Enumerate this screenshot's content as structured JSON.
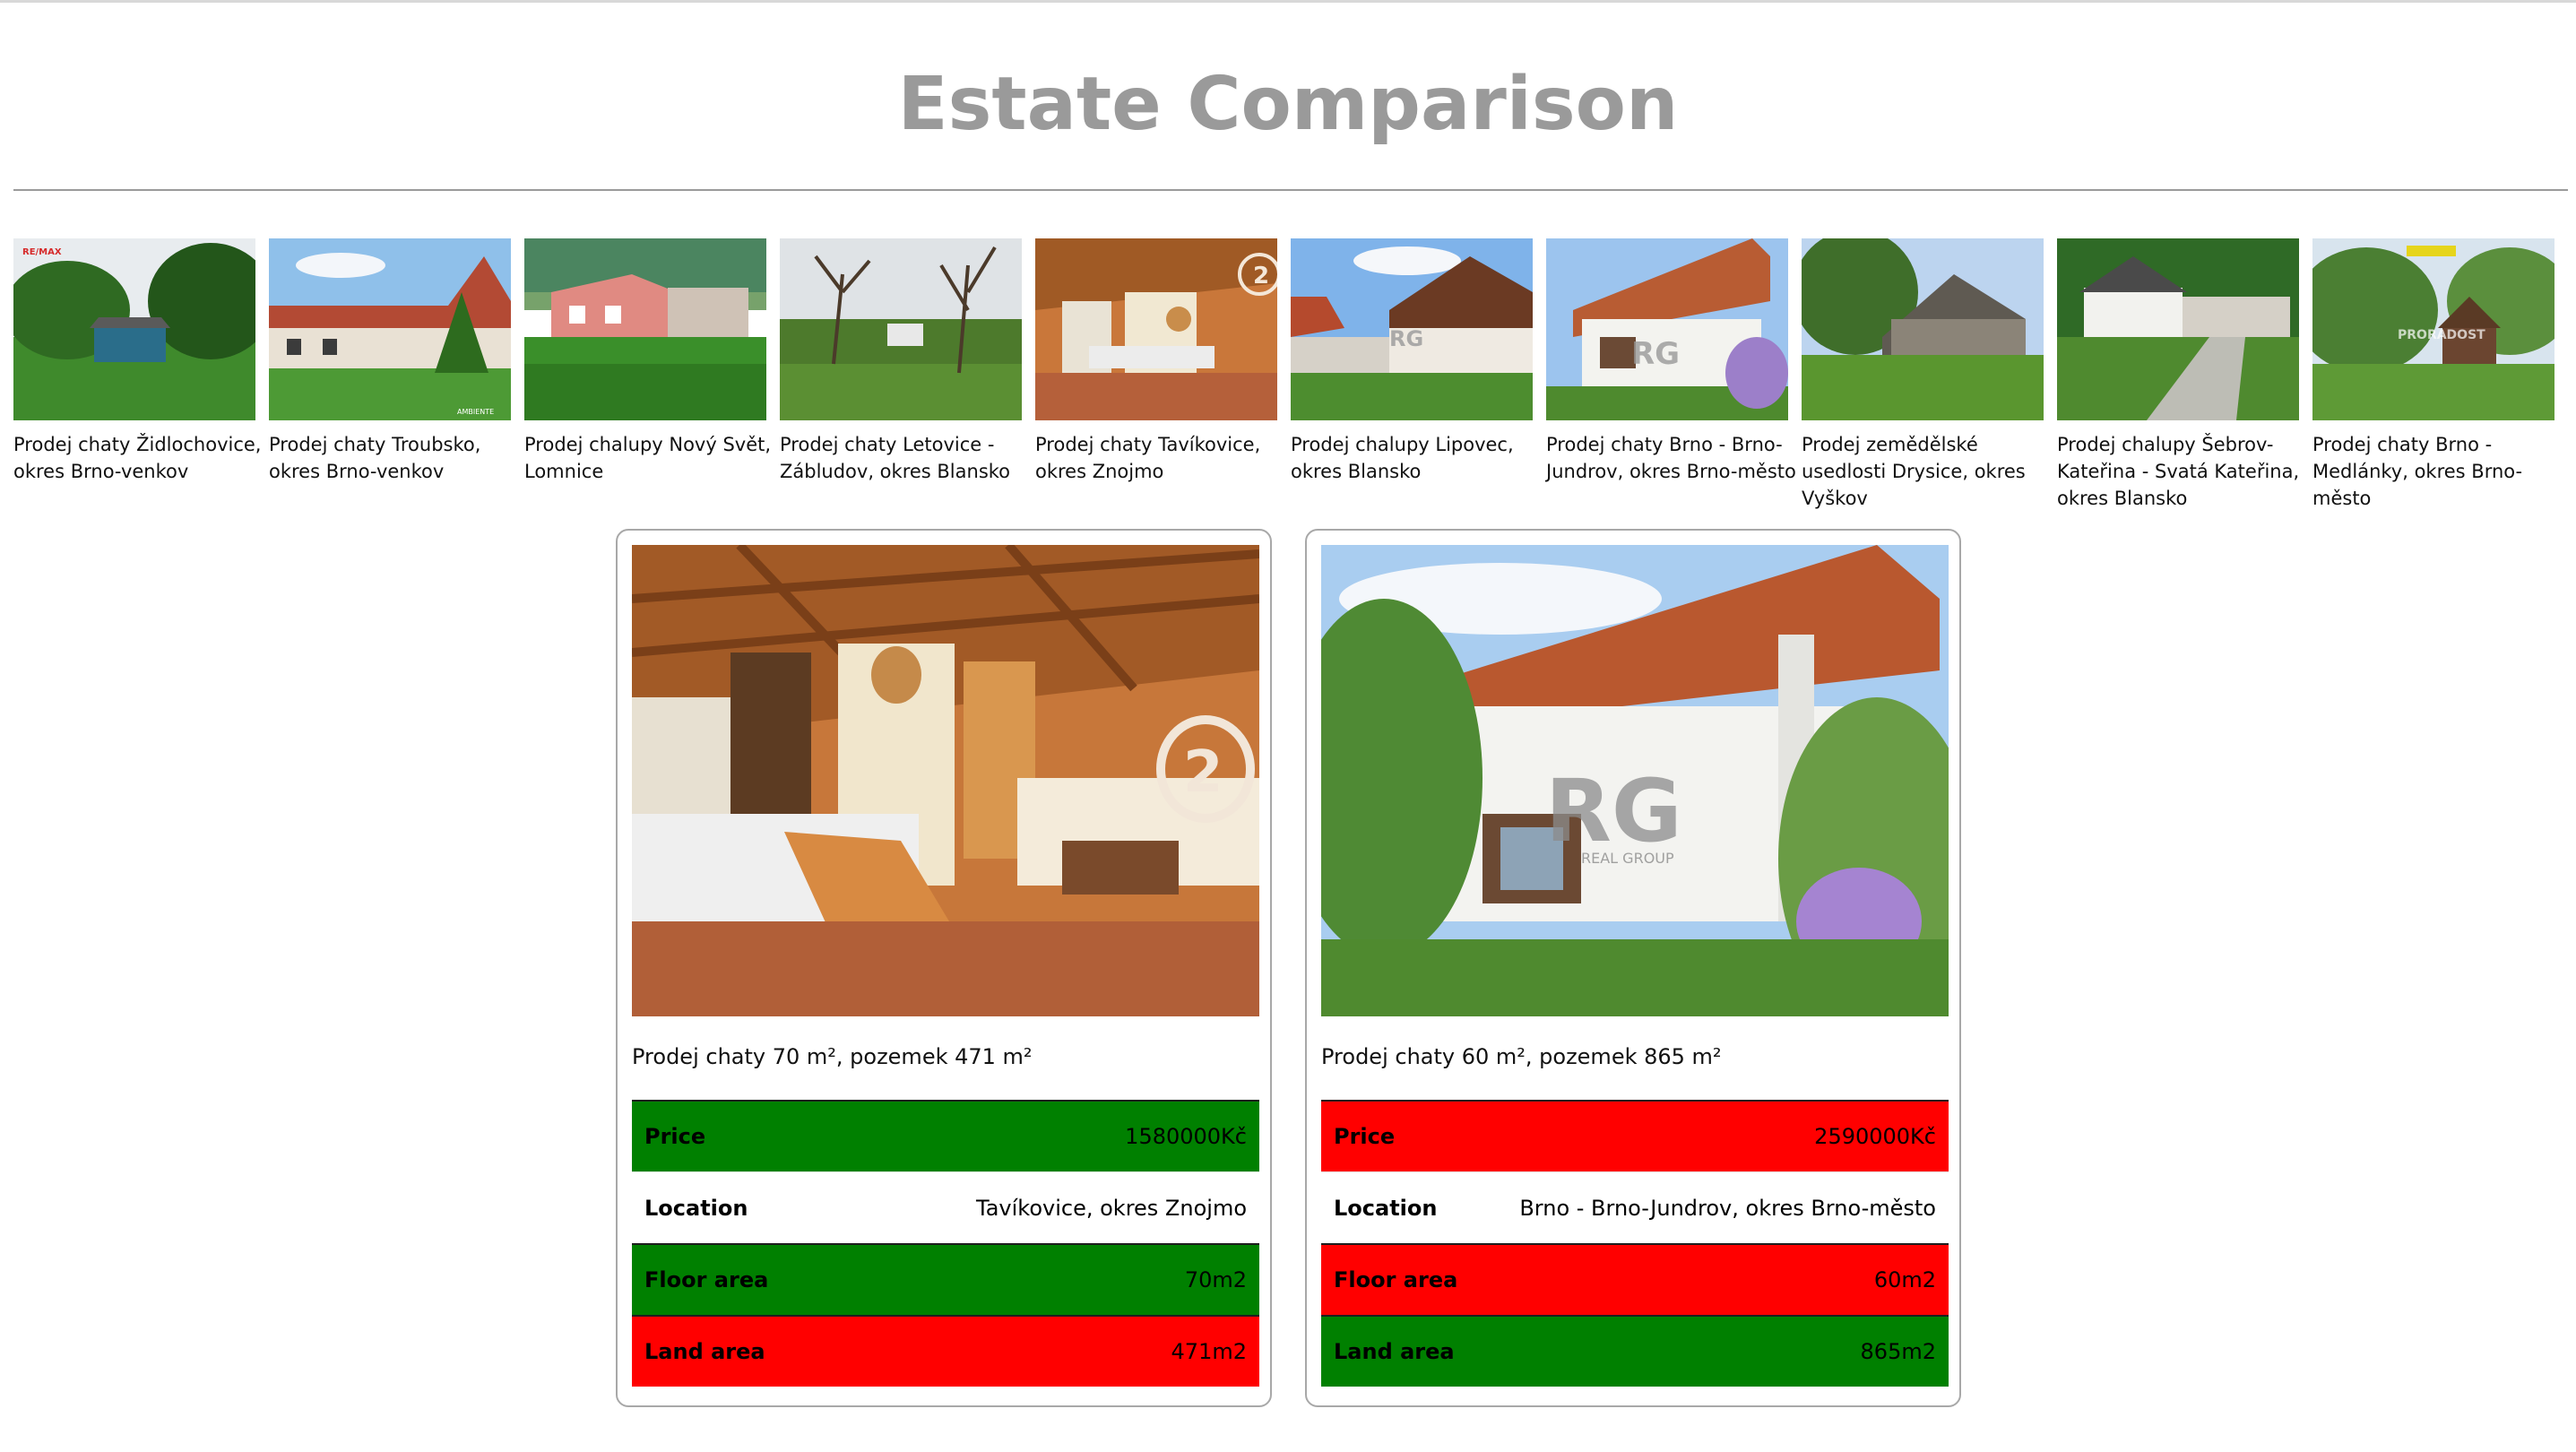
{
  "page": {
    "title": "Estate Comparison"
  },
  "colors": {
    "title": "#9a9a9a",
    "better": "#008000",
    "worse": "#ff0000",
    "neutral": "#ffffff"
  },
  "listings": [
    {
      "label": "Prodej chaty Židlochovice, okres Brno-venkov",
      "logo_text": "RE/MAX"
    },
    {
      "label": "Prodej chaty Troubsko, okres Brno-venkov",
      "logo_text": "AMBIENTE"
    },
    {
      "label": "Prodej chalupy Nový Svět, Lomnice"
    },
    {
      "label": "Prodej chaty Letovice - Zábludov, okres Blansko"
    },
    {
      "label": "Prodej chaty Tavíkovice, okres Znojmo",
      "logo_text": "2"
    },
    {
      "label": "Prodej chalupy Lipovec, okres Blansko",
      "logo_text": "RG"
    },
    {
      "label": "Prodej chaty Brno - Brno-Jundrov, okres Brno-město",
      "logo_text": "RG"
    },
    {
      "label": "Prodej zemědělské usedlosti Drysice, okres Vyškov"
    },
    {
      "label": "Prodej chalupy Šebrov-Kateřina - Svatá Kateřina, okres Blansko"
    },
    {
      "label": "Prodej chaty Brno - Medlánky, okres Brno-město",
      "logo_text": "PRORADOST"
    }
  ],
  "comparison": [
    {
      "title": "Prodej chaty 70 m², pozemek 471 m²",
      "logo_text": "2",
      "rows": [
        {
          "label": "Price",
          "value": "1580000Kč",
          "status": "better"
        },
        {
          "label": "Location",
          "value": "Tavíkovice, okres Znojmo",
          "status": "neutral"
        },
        {
          "label": "Floor area",
          "value": "70m2",
          "status": "better"
        },
        {
          "label": "Land area",
          "value": "471m2",
          "status": "worse"
        }
      ]
    },
    {
      "title": "Prodej chaty 60 m², pozemek 865 m²",
      "logo_text": "RG",
      "logo_subtext": "REAL GROUP",
      "rows": [
        {
          "label": "Price",
          "value": "2590000Kč",
          "status": "worse"
        },
        {
          "label": "Location",
          "value": "Brno - Brno-Jundrov, okres Brno-město",
          "status": "neutral"
        },
        {
          "label": "Floor area",
          "value": "60m2",
          "status": "worse"
        },
        {
          "label": "Land area",
          "value": "865m2",
          "status": "better"
        }
      ]
    }
  ]
}
